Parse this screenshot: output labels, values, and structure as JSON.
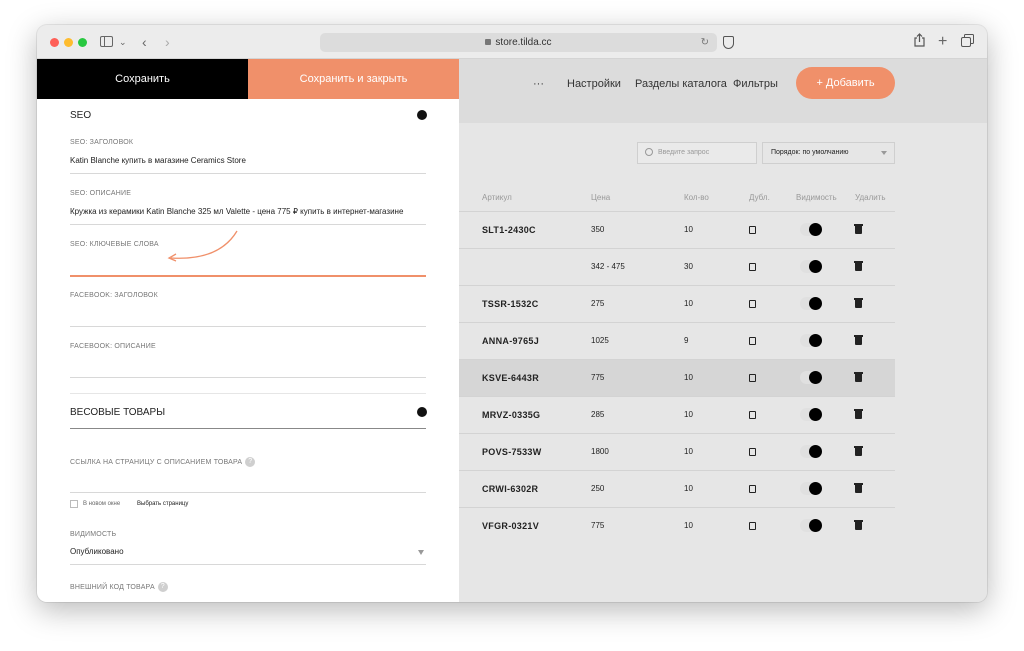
{
  "browser": {
    "url": "store.tilda.cc"
  },
  "editor": {
    "save_label": "Сохранить",
    "save_close_label": "Сохранить и закрыть",
    "seo": {
      "title": "SEO",
      "fields": [
        {
          "label": "SEO: ЗАГОЛОВОК",
          "value": "Katin Blanche купить в магазине Ceramics Store"
        },
        {
          "label": "SEO: ОПИСАНИЕ",
          "value": "Кружка из керамики Katin Blanche 325 мл Valette - цена 775 ₽ купить в интернет-магазине"
        },
        {
          "label": "SEO: КЛЮЧЕВЫЕ СЛОВА",
          "value": ""
        },
        {
          "label": "FACEBOOK: ЗАГОЛОВОК",
          "value": ""
        },
        {
          "label": "FACEBOOK: ОПИСАНИЕ",
          "value": ""
        }
      ]
    },
    "weight": {
      "title": "ВЕСОВЫЕ ТОВАРЫ"
    },
    "link_label": "ССЫЛКА НА СТРАНИЦУ С ОПИСАНИЕМ ТОВАРА",
    "new_window_label": "В новом окне",
    "choose_page_label": "Выбрать страницу",
    "visibility_label": "ВИДИМОСТЬ",
    "visibility_value": "Опубликовано",
    "external_code_label": "ВНЕШНИЙ КОД ТОВАРА"
  },
  "nav": {
    "more": "···",
    "settings": "Настройки",
    "sections": "Разделы каталога",
    "filters": "Фильтры",
    "add": "+ Добавить"
  },
  "catalog": {
    "search_placeholder": "Введите запрос",
    "sort_label": "Порядок: по умолчанию",
    "columns": [
      "Артикул",
      "Цена",
      "Кол-во",
      "Дубл.",
      "Видимость",
      "Удалить"
    ],
    "rows": [
      {
        "sku": "SLT1-2430C",
        "price": "350",
        "qty": "10",
        "visible": true
      },
      {
        "sku": "",
        "price": "342 - 475",
        "qty": "30",
        "visible": true
      },
      {
        "sku": "TSSR-1532C",
        "price": "275",
        "qty": "10",
        "visible": true
      },
      {
        "sku": "ANNA-9765J",
        "price": "1025",
        "qty": "9",
        "visible": true
      },
      {
        "sku": "KSVE-6443R",
        "price": "775",
        "qty": "10",
        "visible": true,
        "highlighted": true
      },
      {
        "sku": "MRVZ-0335G",
        "price": "285",
        "qty": "10",
        "visible": true
      },
      {
        "sku": "POVS-7533W",
        "price": "1800",
        "qty": "10",
        "visible": true
      },
      {
        "sku": "CRWI-6302R",
        "price": "250",
        "qty": "10",
        "visible": true
      },
      {
        "sku": "VFGR-0321V",
        "price": "775",
        "qty": "10",
        "visible": true
      }
    ]
  },
  "colors": {
    "accent": "#f0906a",
    "dark": "#000000",
    "panel_bg": "#e6e6e6"
  }
}
